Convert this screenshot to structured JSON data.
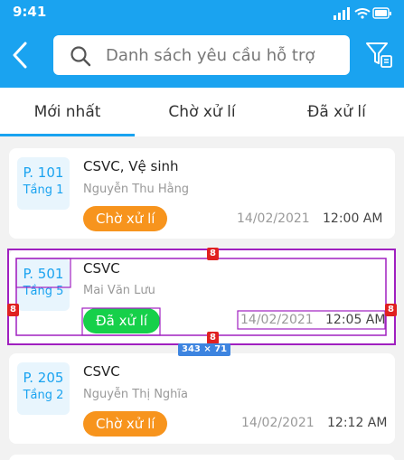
{
  "status_bar": {
    "time": "9:41"
  },
  "header": {
    "search_placeholder": "Danh sách yêu cầu hỗ trợ",
    "icons": [
      "back-arrow-icon",
      "search-icon",
      "filter-icon"
    ]
  },
  "tabs": [
    {
      "label": "Mới nhất",
      "active": true
    },
    {
      "label": "Chờ xử lí",
      "active": false
    },
    {
      "label": "Đã xử lí",
      "active": false
    }
  ],
  "requests": [
    {
      "room": "P. 101",
      "floor": "Tầng 1",
      "category": "CSVC, Vệ sinh",
      "person": "Nguyễn Thu Hằng",
      "status": "Chờ xử lí",
      "date": "14/02/2021",
      "time": "12:00 AM"
    },
    {
      "room": "P. 501",
      "floor": "Tầng 5",
      "category": "CSVC",
      "person": "Mai Văn Lưu",
      "status": "Đã xử lí",
      "date": "14/02/2021",
      "time": "12:05 AM"
    },
    {
      "room": "P. 205",
      "floor": "Tầng 2",
      "category": "CSVC",
      "person": "Nguyễn Thị Nghĩa",
      "status": "Chờ xử lí",
      "date": "14/02/2021",
      "time": "12:12 AM"
    }
  ],
  "inspector": {
    "spacing_labels": [
      "8",
      "8",
      "8",
      "8"
    ],
    "size_label": "343 × 71"
  },
  "colors": {
    "primary": "#1aa3f0",
    "pending": "#f7941d",
    "done": "#16d04a",
    "guide": "#a020c0",
    "measure": "#e02020"
  }
}
